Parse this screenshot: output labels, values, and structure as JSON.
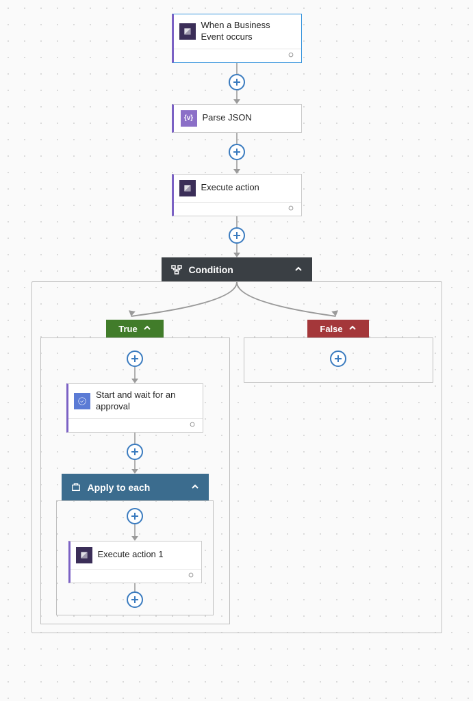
{
  "trigger": {
    "title": "When a Business Event occurs"
  },
  "steps": {
    "parseJson": {
      "title": "Parse JSON"
    },
    "executeAction": {
      "title": "Execute action"
    }
  },
  "condition": {
    "title": "Condition",
    "trueLabel": "True",
    "falseLabel": "False",
    "trueBranch": {
      "approval": {
        "title": "Start and wait for an approval"
      },
      "applyToEach": {
        "title": "Apply to each",
        "inner": {
          "executeAction1": {
            "title": "Execute action 1"
          }
        }
      }
    }
  }
}
